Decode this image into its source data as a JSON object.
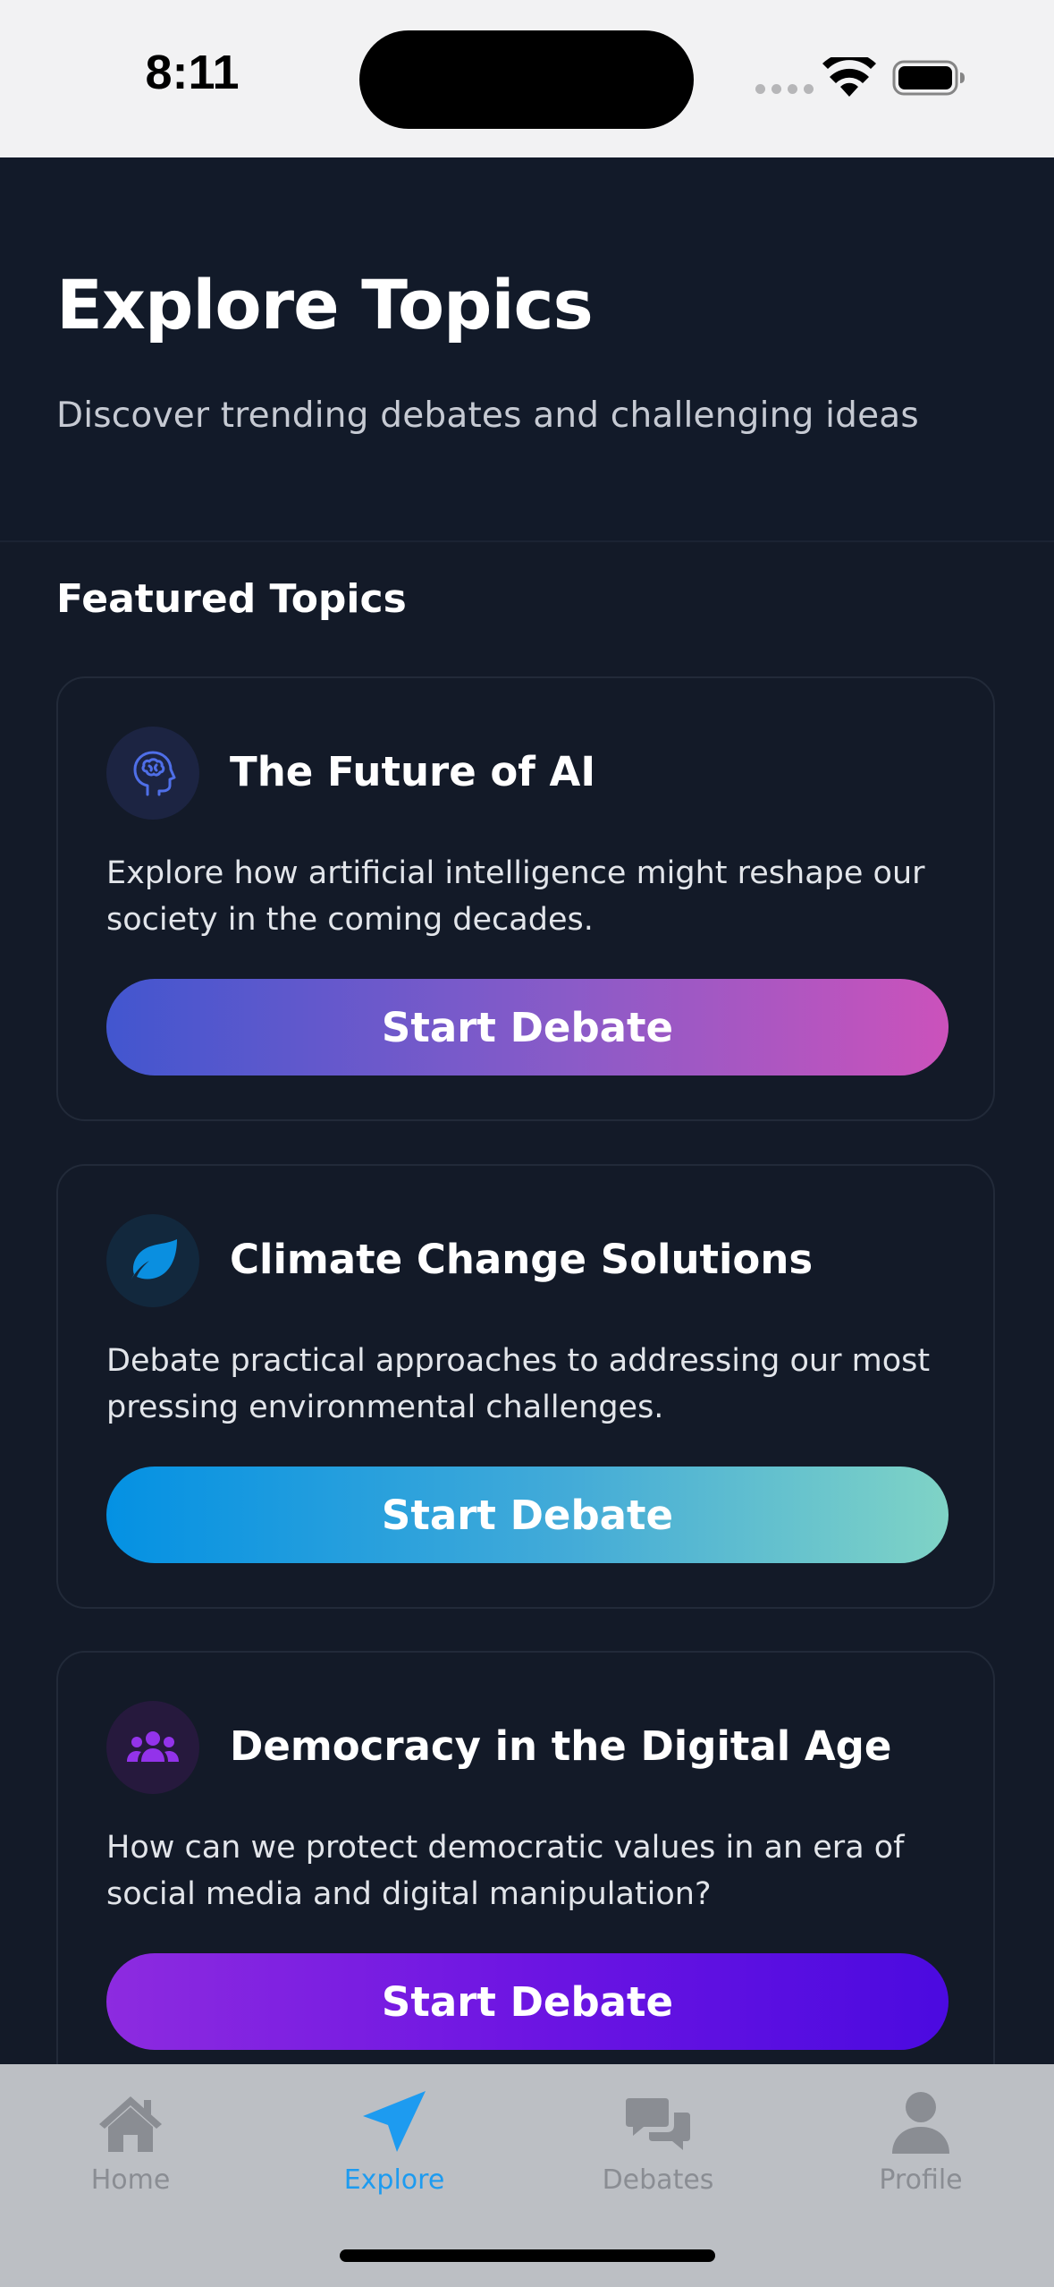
{
  "status_bar": {
    "time": "8:11"
  },
  "header": {
    "title": "Explore Topics",
    "subtitle": "Discover trending debates and challenging ideas"
  },
  "section": {
    "title": "Featured Topics"
  },
  "topics": [
    {
      "icon": "brain-head-icon",
      "accent": "#4256cf",
      "title": "The Future of AI",
      "description": "Explore how artificial intelligence might reshape our society in the coming decades.",
      "button_label": "Start Debate"
    },
    {
      "icon": "leaf-icon",
      "accent": "#0491e3",
      "title": "Climate Change Solutions",
      "description": "Debate practical approaches to addressing our most pressing environmental challenges.",
      "button_label": "Start Debate"
    },
    {
      "icon": "people-group-icon",
      "accent": "#8d2be0",
      "title": "Democracy in the Digital Age",
      "description": "How can we protect democratic values in an era of social media and digital manipulation?",
      "button_label": "Start Debate"
    }
  ],
  "tab_bar": {
    "active": "Explore",
    "active_color": "#1d9bf0",
    "items": [
      {
        "label": "Home",
        "icon": "home-icon"
      },
      {
        "label": "Explore",
        "icon": "paper-plane-icon"
      },
      {
        "label": "Debates",
        "icon": "chat-bubbles-icon"
      },
      {
        "label": "Profile",
        "icon": "user-icon"
      }
    ]
  }
}
